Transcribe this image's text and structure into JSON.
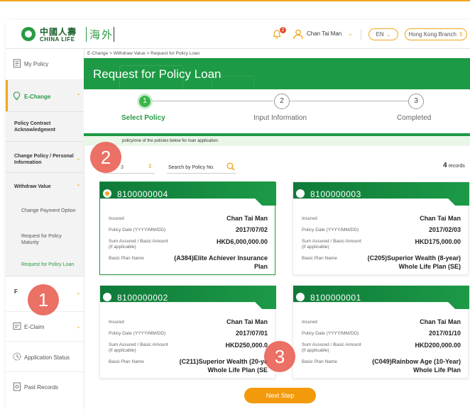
{
  "header": {
    "brand_cn": "中國人壽",
    "brand_en": "CHINA LIFE",
    "brand_overseas": "海外",
    "notification_count": "2",
    "user_name": "Chan Tai Man",
    "language": "EN",
    "branch": "Hong Kong Branch"
  },
  "sidebar": {
    "my_policy": "My Policy",
    "echange": "E-Change",
    "policy_contract": "Policy Contract Acknowledgment",
    "change_policy": "Change Policy / Personal Information",
    "withdraw_value": "Withdraw Value",
    "change_payment": "Change Payment Option",
    "request_maturity": "Request for Policy Maturity",
    "request_loan": "Request for Policy Loan",
    "eclaim": "E-Claim",
    "application_status": "Application Status",
    "past_records": "Past Records"
  },
  "breadcrumb": "E-Change  >  Withdraw Value  >  Request for Policy Loan",
  "page_title": "Request for Policy Loan",
  "steps": [
    {
      "num": "1",
      "label": "Select Policy"
    },
    {
      "num": "2",
      "label": "Input Information"
    },
    {
      "num": "3",
      "label": "Completed"
    }
  ],
  "notice": "policy/one of the policies below for loan application.",
  "filter": {
    "value": "3",
    "search_placeholder": "Search by Policy No.",
    "records_count": "4",
    "records_label": "records"
  },
  "labels": {
    "insured": "Insured",
    "policy_date": "Policy Date (YYYY/MM/DD)",
    "sum_assured": "Sum Assured / Basic Amount",
    "if_applicable": "(if applicable)",
    "plan_name": "Basic Plan Name"
  },
  "policies": [
    {
      "policy_no": "8100000004",
      "insured": "Chan Tai Man",
      "date": "2017/07/02",
      "amount": "HKD6,000,000.00",
      "plan1": "(A384)Elite Achiever Insurance",
      "plan2": "Plan"
    },
    {
      "policy_no": "8100000003",
      "insured": "Chan Tai Man",
      "date": "2017/02/03",
      "amount": "HKD175,000.00",
      "plan1": "(C205)Superior Wealth (8-year)",
      "plan2": "Whole Life Plan (SE)"
    },
    {
      "policy_no": "8100000002",
      "insured": "Chan Tai Man",
      "date": "2017/07/01",
      "amount": "HKD250,000.0",
      "plan1": "(C211)Superior Wealth (20-ye",
      "plan2": "Whole Life Plan (SE"
    },
    {
      "policy_no": "8100000001",
      "insured": "Chan Tai Man",
      "date": "2017/01/10",
      "amount": "HKD200,000.00",
      "plan1": "(C049)Rainbow Age (10-Year)",
      "plan2": "Whole Life Plan"
    }
  ],
  "next_button": "Next Step",
  "markers": [
    "1",
    "2",
    "3"
  ],
  "colors": {
    "brand_green": "#1d9a45",
    "accent_orange": "#f39a0c",
    "marker_red": "#e85c50"
  }
}
